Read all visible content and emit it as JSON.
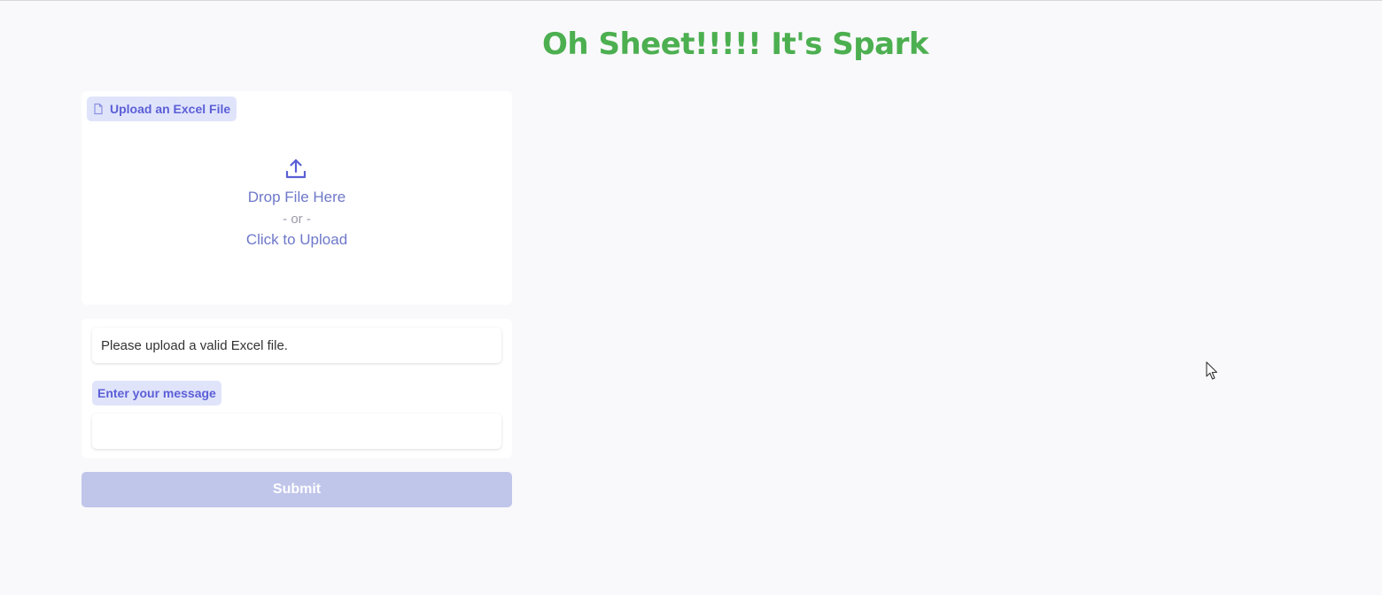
{
  "header": {
    "title": "Oh Sheet!!!!! It's Spark",
    "title_color": "#4caf50"
  },
  "upload": {
    "label": "Upload an Excel File",
    "label_icon": "file-icon",
    "drop_text": "Drop File Here",
    "or_text": "- or -",
    "click_text": "Click to Upload",
    "upload_icon": "upload-icon"
  },
  "status": {
    "text": "Please upload a valid Excel file."
  },
  "message": {
    "label": "Enter your message",
    "value": "",
    "placeholder": ""
  },
  "actions": {
    "submit_label": "Submit"
  },
  "colors": {
    "accent": "#5b5fd6",
    "label_bg": "#e0e4fb",
    "submit_bg": "#c0c5ea",
    "background": "#f9f9fb"
  }
}
